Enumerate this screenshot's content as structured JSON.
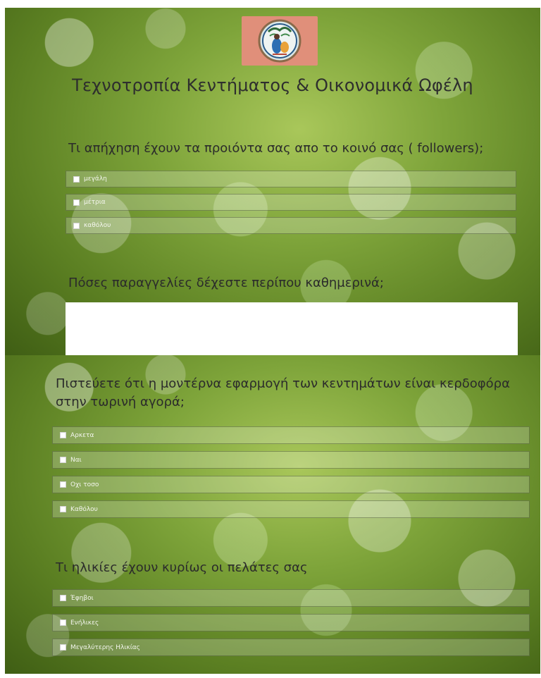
{
  "form": {
    "title": "Τεχνοτροπία Κεντήματος & Οικονομικά Ωφέλη",
    "logo": "embroidery-hoop-logo",
    "questions": [
      {
        "label": "Τι απήχηση έχουν τα προιόντα σας απο το κοινό σας ( followers);",
        "options": [
          "μεγάλη",
          "μέτρια",
          "καθόλου"
        ]
      },
      {
        "label": "Πόσες παραγγελίες δέχεστε περίπου καθημερινά;",
        "answer_value": ""
      },
      {
        "label": "Πιστεύετε ότι η μοντέρνα εφαρμογή των κεντημάτων είναι κερδοφόρα στην τωρινή αγορά;",
        "options": [
          "Αρκετα",
          "Ναι",
          "Οχι τοσο",
          "Καθόλου"
        ]
      },
      {
        "label": "Τι ηλικίες έχουν κυρίως οι πελάτες σας",
        "options": [
          "Έφηβοι",
          "Ενήλικες",
          "Μεγαλύτερης Ηλικίας"
        ]
      }
    ]
  },
  "colors": {
    "background_green": "#6f9430",
    "logo_background": "#e08f7a",
    "text_dark": "#2b2b2b"
  }
}
